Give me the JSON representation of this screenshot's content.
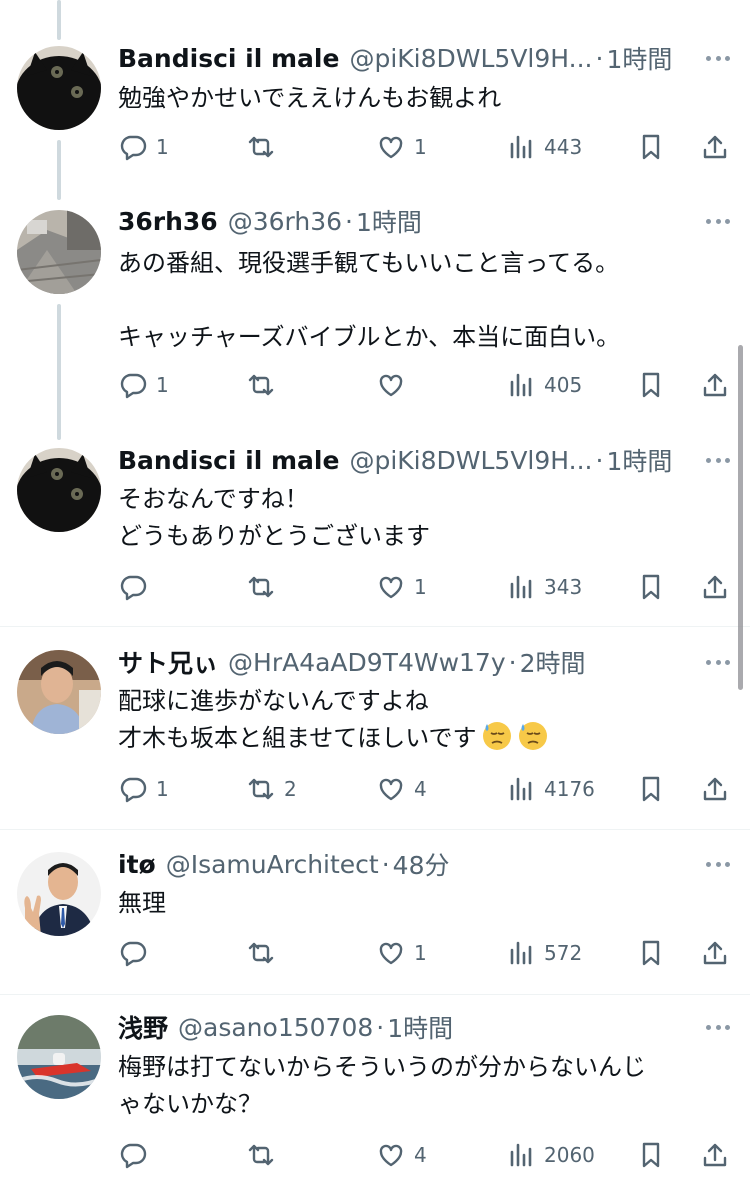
{
  "tweets": [
    {
      "name": "Bandisci il male",
      "handle": "@piKi8DWL5Vl9H...",
      "sep": "·",
      "time": "1時間",
      "text": "勉強やかせいでええけんもお観よれ",
      "replies": "1",
      "retweets": "",
      "likes": "1",
      "views": "443",
      "avatar": "black-cat-avatar"
    },
    {
      "name": "36rh36",
      "handle": "@36rh36",
      "sep": "·",
      "time": "1時間",
      "text": "あの番組、現役選手観てもいいこと言ってる。\n\nキャッチャーズバイブルとか、本当に面白い。",
      "replies": "1",
      "retweets": "",
      "likes": "",
      "views": "405",
      "avatar": "street-photo-avatar"
    },
    {
      "name": "Bandisci il male",
      "handle": "@piKi8DWL5Vl9H...",
      "sep": "·",
      "time": "1時間",
      "text": "そおなんですね！\nどうもありがとうございます",
      "replies": "",
      "retweets": "",
      "likes": "1",
      "views": "343",
      "avatar": "black-cat-avatar"
    },
    {
      "name": "サト兄ぃ",
      "handle": "@HrA4aAD9T4Ww17y",
      "sep": "·",
      "time": "2時間",
      "text": "配球に進歩がないんですよね\n才木も坂本と組ませてほしいです",
      "emoji": "sweat-face-emoji",
      "replies": "1",
      "retweets": "2",
      "likes": "4",
      "views": "4176",
      "avatar": "person-avatar"
    },
    {
      "name": "itø",
      "handle": "@IsamuArchitect",
      "sep": "·",
      "time": "48分",
      "text": "無理",
      "replies": "",
      "retweets": "",
      "likes": "1",
      "views": "572",
      "avatar": "suit-man-avatar"
    },
    {
      "name": "浅野",
      "handle": "@asano150708",
      "sep": "·",
      "time": "1時間",
      "text": "梅野は打てないからそういうのが分からないんじ\nゃないかな？",
      "replies": "",
      "retweets": "",
      "likes": "4",
      "views": "2060",
      "avatar": "boat-race-avatar"
    }
  ],
  "colors": {
    "text": "#0f1419",
    "muted": "#536471",
    "thread_line": "#cfd9de",
    "separator": "#eff3f4"
  }
}
